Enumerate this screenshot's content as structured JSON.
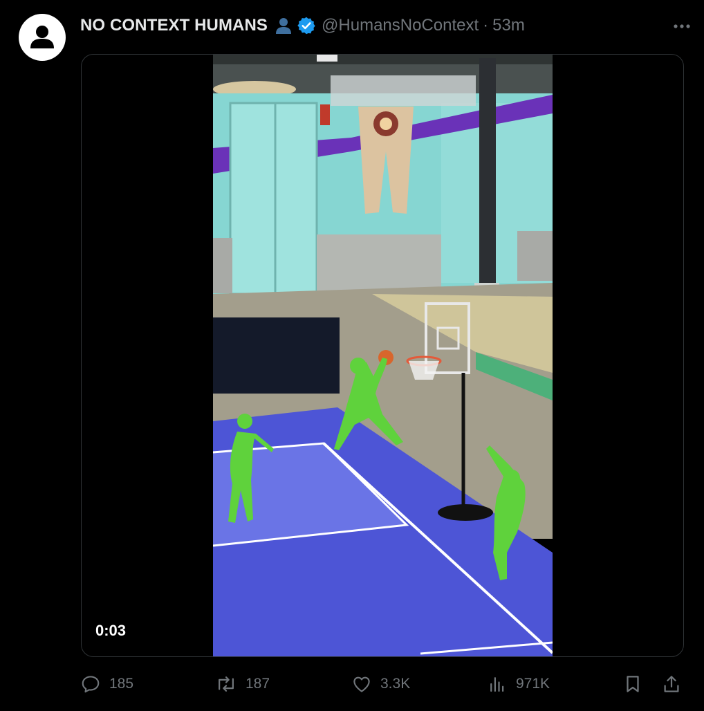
{
  "tweet": {
    "author_name": "NO CONTEXT HUMANS",
    "handle": "@HumansNoContext",
    "separator": "·",
    "time": "53m",
    "video_time": "0:03"
  },
  "actions": {
    "replies": "185",
    "reposts": "187",
    "likes": "3.3K",
    "views": "971K"
  },
  "icons": {
    "avatar": "default-avatar-icon",
    "affiliate": "person-badge-icon",
    "verified": "verified-badge-icon",
    "more": "more-dots-icon",
    "reply": "reply-icon",
    "repost": "repost-icon",
    "like": "heart-icon",
    "views": "views-icon",
    "bookmark": "bookmark-icon",
    "share": "share-icon"
  },
  "colors": {
    "background": "#000000",
    "text": "#e7e9ea",
    "muted": "#71767b",
    "verified": "#1d9bf0",
    "court": "#5158d9",
    "wall": "#7fd6d0",
    "suit": "#5fd23c"
  }
}
